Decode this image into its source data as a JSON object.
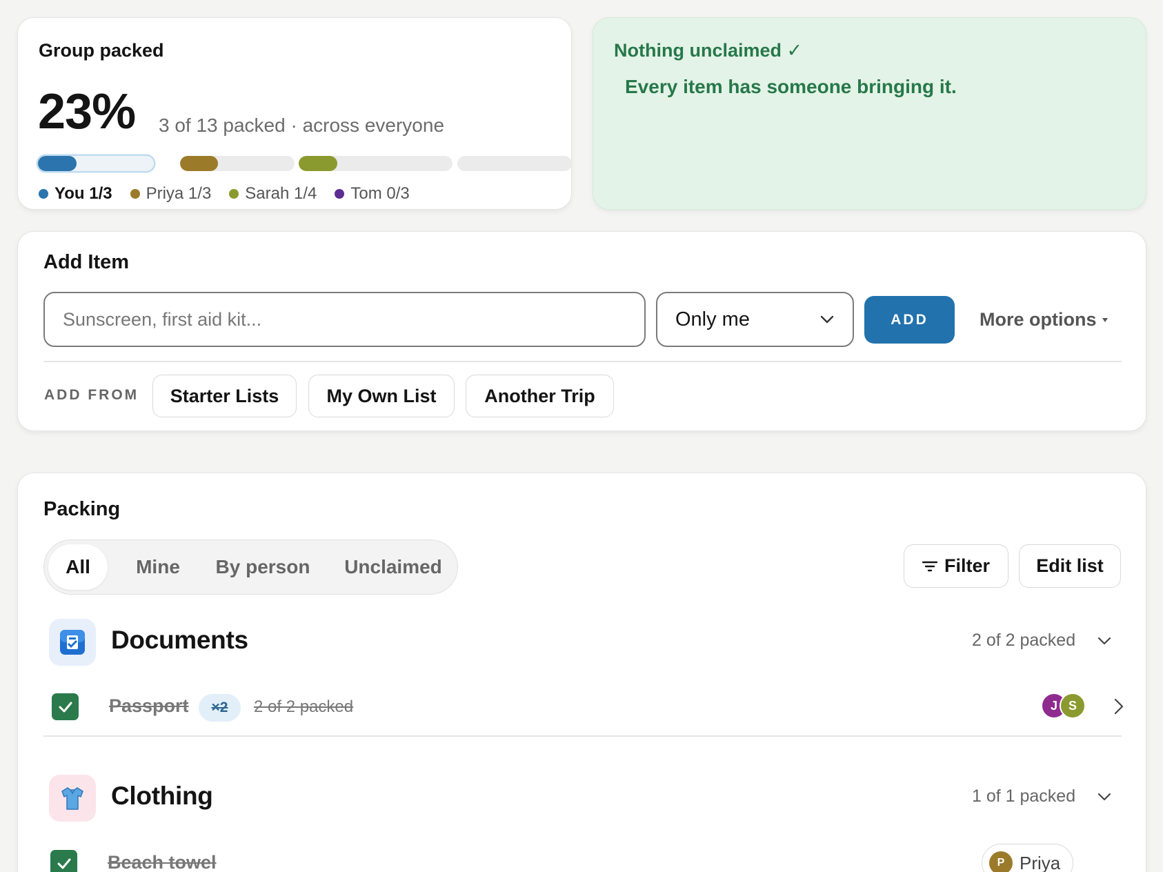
{
  "group": {
    "title": "Group packed",
    "percent": "23%",
    "subtitle": "3 of 13 packed · across everyone",
    "people": [
      {
        "name": "You",
        "progress": "1/3",
        "label": "You 1/3",
        "fraction": 0.333,
        "color": "#2b74ad",
        "selected": true
      },
      {
        "name": "Priya",
        "progress": "1/3",
        "label": "Priya 1/3",
        "fraction": 0.333,
        "color": "#9b7a2a"
      },
      {
        "name": "Sarah",
        "progress": "1/4",
        "label": "Sarah 1/4",
        "fraction": 0.25,
        "color": "#8a9a2e"
      },
      {
        "name": "Tom",
        "progress": "0/3",
        "label": "Tom 0/3",
        "fraction": 0,
        "color": "#5d2d91"
      }
    ]
  },
  "unclaimed": {
    "title": "Nothing unclaimed ✓",
    "message": "Every item has someone bringing it."
  },
  "add_item": {
    "title": "Add Item",
    "placeholder": "Sunscreen, first aid kit...",
    "assignee": "Only me",
    "add_label": "ADD",
    "more_options": "More options",
    "add_from_label": "ADD FROM",
    "sources": [
      "Starter Lists",
      "My Own List",
      "Another Trip"
    ]
  },
  "packing": {
    "title": "Packing",
    "tabs": [
      "All",
      "Mine",
      "By person",
      "Unclaimed"
    ],
    "active_tab": "All",
    "filter_label": "Filter",
    "edit_label": "Edit list",
    "categories": [
      {
        "name": "Documents",
        "icon": "passport-control-icon",
        "count": "2 of 2 packed",
        "items": [
          {
            "name": "Passport",
            "qty": "×2",
            "count": "2 of 2 packed",
            "checked": true,
            "assignees": [
              {
                "initial": "J",
                "color": "#8f2b8f"
              },
              {
                "initial": "S",
                "color": "#8a9a2e"
              }
            ]
          }
        ]
      },
      {
        "name": "Clothing",
        "icon": "shirt-icon",
        "count": "1 of 1 packed",
        "items": [
          {
            "name": "Beach towel",
            "checked": true,
            "assignee": {
              "initial": "P",
              "name": "Priya",
              "color": "#9b7a2a"
            }
          }
        ]
      }
    ]
  },
  "colors": {
    "accent": "#2272ad",
    "success_text": "#26784a",
    "success_bg": "#e4f3e7",
    "check": "#2a7a4b"
  }
}
